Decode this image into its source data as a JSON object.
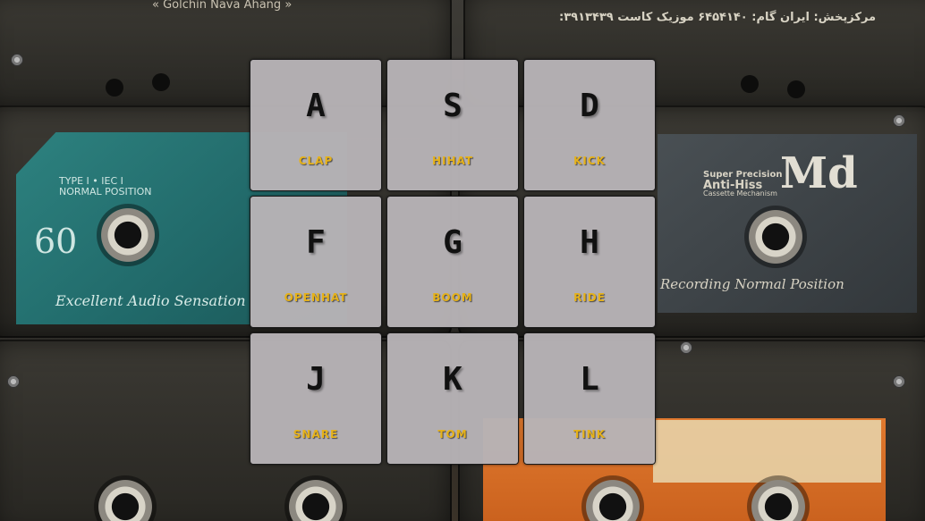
{
  "background": {
    "top_left_brand": "Golchin Nava Ahang",
    "top_right_persian": "مرکزپخش: ایران گام: ۶۴۵۴۱۴۰ موزیک کاست ۳۹۱۳۴۳۹:",
    "teal_label": {
      "type_text": "TYPE I • IEC I",
      "position_text": "NORMAL POSITION",
      "number": "60",
      "tagline": "Excellent Audio Sensation"
    },
    "grey_label": {
      "precision_line1": "Super Precision",
      "precision_line2": "Anti-Hiss",
      "precision_line3": "Cassette Mechanism",
      "brand": "Md",
      "tagline": "Recording Normal Position"
    }
  },
  "pads": [
    {
      "key": "A",
      "sound": "CLAP"
    },
    {
      "key": "S",
      "sound": "HIHAT"
    },
    {
      "key": "D",
      "sound": "KICK"
    },
    {
      "key": "F",
      "sound": "OPENHAT"
    },
    {
      "key": "G",
      "sound": "BOOM"
    },
    {
      "key": "H",
      "sound": "RIDE"
    },
    {
      "key": "J",
      "sound": "SNARE"
    },
    {
      "key": "K",
      "sound": "TOM"
    },
    {
      "key": "L",
      "sound": "TINK"
    }
  ],
  "colors": {
    "pad_background": "#b7b3b6",
    "key_text": "#111111",
    "sound_text": "#e6b21a"
  }
}
